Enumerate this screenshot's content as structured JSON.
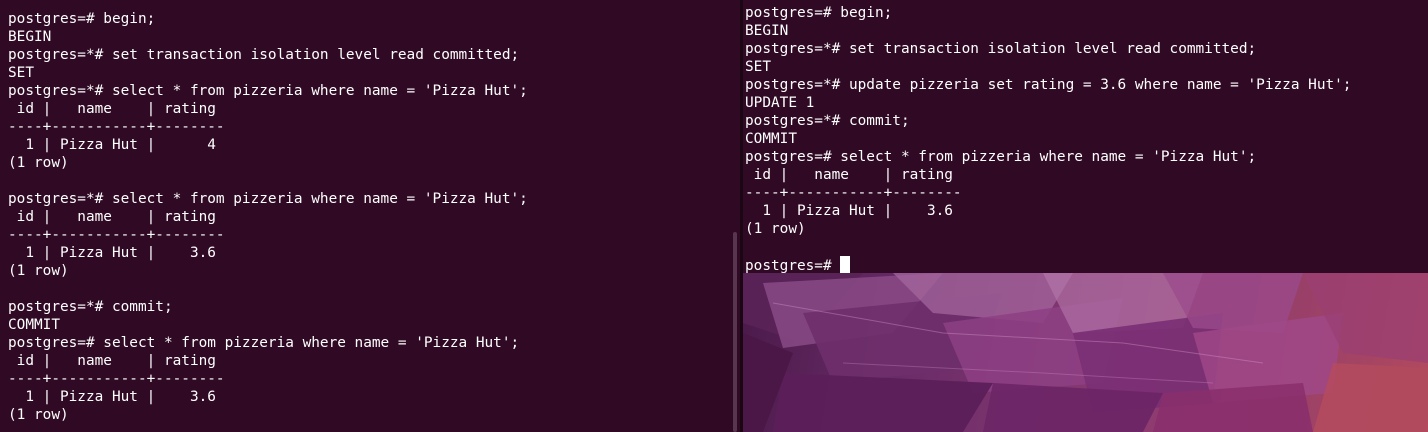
{
  "left_terminal": {
    "lines": [
      "postgres=# begin;",
      "BEGIN",
      "postgres=*# set transaction isolation level read committed;",
      "SET",
      "postgres=*# select * from pizzeria where name = 'Pizza Hut';",
      " id |   name    | rating",
      "----+-----------+--------",
      "  1 | Pizza Hut |      4",
      "(1 row)",
      "",
      "postgres=*# select * from pizzeria where name = 'Pizza Hut';",
      " id |   name    | rating",
      "----+-----------+--------",
      "  1 | Pizza Hut |    3.6",
      "(1 row)",
      "",
      "postgres=*# commit;",
      "COMMIT",
      "postgres=# select * from pizzeria where name = 'Pizza Hut';",
      " id |   name    | rating",
      "----+-----------+--------",
      "  1 | Pizza Hut |    3.6",
      "(1 row)"
    ]
  },
  "right_terminal": {
    "lines": [
      "postgres=# begin;",
      "BEGIN",
      "postgres=*# set transaction isolation level read committed;",
      "SET",
      "postgres=*# update pizzeria set rating = 3.6 where name = 'Pizza Hut';",
      "UPDATE 1",
      "postgres=*# commit;",
      "COMMIT",
      "postgres=# select * from pizzeria where name = 'Pizza Hut';",
      " id |   name    | rating",
      "----+-----------+--------",
      "  1 | Pizza Hut |    3.6",
      "(1 row)",
      ""
    ],
    "prompt": "postgres=# "
  },
  "colors": {
    "terminal_bg": "#300a24",
    "terminal_fg": "#ffffff",
    "wallpaper_accent": "#b24a5e"
  }
}
